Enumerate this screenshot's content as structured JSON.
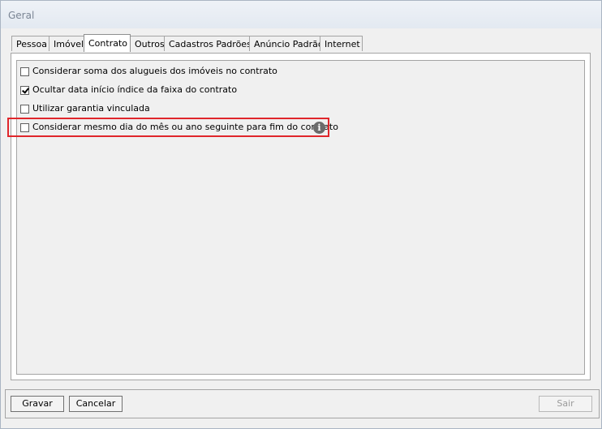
{
  "window": {
    "title": "Geral"
  },
  "tabs": [
    {
      "label": "Pessoa",
      "active": false
    },
    {
      "label": "Imóvel",
      "active": false
    },
    {
      "label": "Contrato",
      "active": true
    },
    {
      "label": "Outros",
      "active": false
    },
    {
      "label": "Cadastros Padrões",
      "active": false
    },
    {
      "label": "Anúncio Padrão",
      "active": false
    },
    {
      "label": "Internet",
      "active": false
    }
  ],
  "options": [
    {
      "label": "Considerar soma dos alugueis dos imóveis no contrato",
      "checked": false
    },
    {
      "label": "Ocultar data início índice da faixa do contrato",
      "checked": true
    },
    {
      "label": "Utilizar garantia vinculada",
      "checked": false
    },
    {
      "label": "Considerar mesmo dia do mês ou ano seguinte para fim do contrato",
      "checked": false,
      "highlighted": true
    }
  ],
  "info_icon": {
    "icon": "info-icon",
    "glyph": "i"
  },
  "buttons": {
    "save": "Gravar",
    "cancel": "Cancelar",
    "exit": "Sair"
  },
  "colors": {
    "highlight": "#e0262b"
  }
}
